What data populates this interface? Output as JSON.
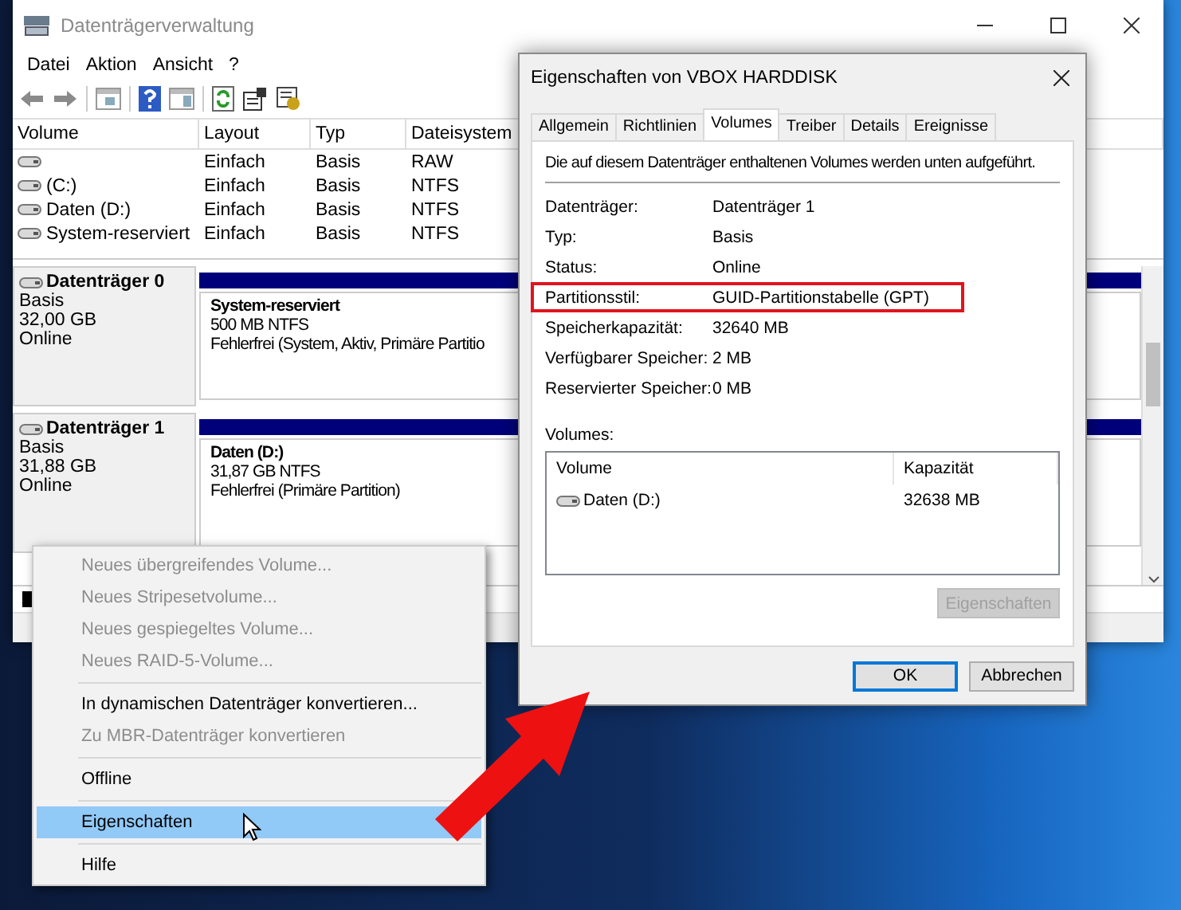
{
  "main_window": {
    "title": "Datenträgerverwaltung",
    "menu": [
      "Datei",
      "Aktion",
      "Ansicht",
      "?"
    ],
    "table": {
      "columns": [
        "Volume",
        "Layout",
        "Typ",
        "Dateisystem"
      ],
      "rows": [
        {
          "layout": "Einfach",
          "type": "Basis",
          "filesystem": "RAW"
        },
        {
          "volume": "(C:)",
          "layout": "Einfach",
          "type": "Basis",
          "filesystem": "NTFS"
        },
        {
          "volume": "Daten (D:)",
          "layout": "Einfach",
          "type": "Basis",
          "filesystem": "NTFS"
        },
        {
          "volume": "System-reserviert",
          "layout": "Einfach",
          "type": "Basis",
          "filesystem": "NTFS"
        }
      ]
    },
    "disks": [
      {
        "name": "Datenträger 0",
        "type": "Basis",
        "size": "32,00 GB",
        "status": "Online",
        "partition": {
          "name": "System-reserviert",
          "size": "500 MB NTFS",
          "status": "Fehlerfrei (System, Aktiv, Primäre Partitio"
        }
      },
      {
        "name": "Datenträger 1",
        "type": "Basis",
        "size": "31,88 GB",
        "status": "Online",
        "partition": {
          "name": "Daten  (D:)",
          "size": "31,87 GB NTFS",
          "status": "Fehlerfrei (Primäre Partition)"
        }
      }
    ]
  },
  "dialog": {
    "title": "Eigenschaften von VBOX HARDDISK",
    "tabs": [
      {
        "label": "Allgemein",
        "selected": false
      },
      {
        "label": "Richtlinien",
        "selected": false
      },
      {
        "label": "Volumes",
        "selected": true
      },
      {
        "label": "Treiber",
        "selected": false
      },
      {
        "label": "Details",
        "selected": false
      },
      {
        "label": "Ereignisse",
        "selected": false
      }
    ],
    "description": "Die auf diesem Datenträger enthaltenen Volumes werden unten aufgeführt.",
    "properties": [
      {
        "label": "Datenträger:",
        "value": "Datenträger 1",
        "highlighted": false
      },
      {
        "label": "Typ:",
        "value": "Basis",
        "highlighted": false
      },
      {
        "label": "Status:",
        "value": "Online",
        "highlighted": false
      },
      {
        "label": "Partitionsstil:",
        "value": "GUID-Partitionstabelle (GPT)",
        "highlighted": true
      },
      {
        "label": "Speicherkapazität:",
        "value": "32640 MB",
        "highlighted": false
      },
      {
        "label": "Verfügbarer Speicher:",
        "value": "2 MB",
        "highlighted": false
      },
      {
        "label": "Reservierter Speicher:",
        "value": "0 MB",
        "highlighted": false
      }
    ],
    "volumes_label": "Volumes:",
    "volumes_table": {
      "columns": [
        "Volume",
        "Kapazität"
      ],
      "rows": [
        {
          "volume": "Daten (D:)",
          "capacity": "32638 MB"
        }
      ]
    },
    "properties_button": {
      "label": "Eigenschaften",
      "disabled": true
    },
    "buttons": [
      {
        "label": "OK",
        "default": true
      },
      {
        "label": "Abbrechen",
        "default": false
      }
    ]
  },
  "context_menu": {
    "groups": [
      {
        "items": [
          {
            "label": "Neues übergreifendes Volume...",
            "disabled": true,
            "selected": false
          },
          {
            "label": "Neues Stripesetvolume...",
            "disabled": true,
            "selected": false
          },
          {
            "label": "Neues gespiegeltes Volume...",
            "disabled": true,
            "selected": false
          },
          {
            "label": "Neues RAID-5-Volume...",
            "disabled": true,
            "selected": false
          }
        ]
      },
      {
        "items": [
          {
            "label": "In dynamischen Datenträger konvertieren...",
            "disabled": false,
            "selected": false
          },
          {
            "label": "Zu MBR-Datenträger konvertieren",
            "disabled": true,
            "selected": false
          }
        ]
      },
      {
        "items": [
          {
            "label": "Offline",
            "disabled": false,
            "selected": false
          }
        ]
      },
      {
        "items": [
          {
            "label": "Eigenschaften",
            "disabled": false,
            "selected": true
          }
        ]
      },
      {
        "items": [
          {
            "label": "Hilfe",
            "disabled": false,
            "selected": false
          }
        ]
      }
    ]
  }
}
